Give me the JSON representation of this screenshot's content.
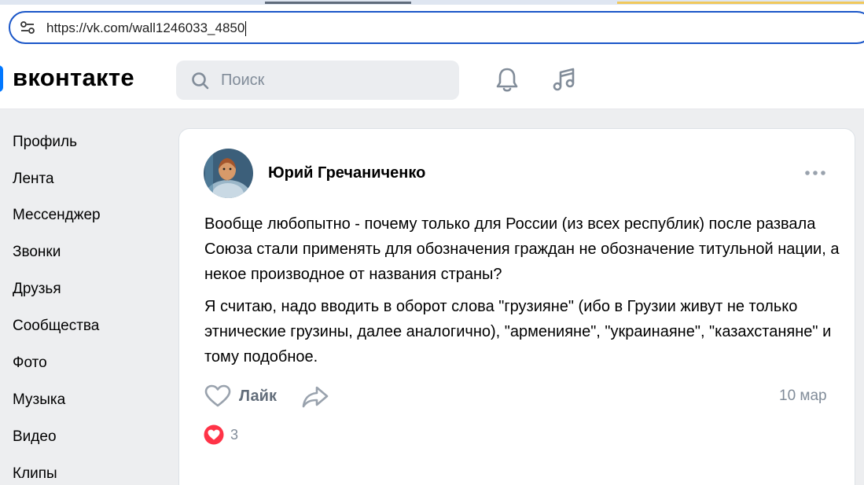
{
  "browser": {
    "url": "https://vk.com/wall1246033_4850"
  },
  "header": {
    "logo_text": "вконтакте",
    "search_placeholder": "Поиск",
    "icons": [
      "search-icon",
      "bell-icon",
      "music-icon"
    ]
  },
  "sidebar": {
    "items": [
      {
        "label": "Профиль"
      },
      {
        "label": "Лента"
      },
      {
        "label": "Мессенджер"
      },
      {
        "label": "Звонки"
      },
      {
        "label": "Друзья"
      },
      {
        "label": "Сообщества"
      },
      {
        "label": "Фото"
      },
      {
        "label": "Музыка"
      },
      {
        "label": "Видео"
      },
      {
        "label": "Клипы"
      }
    ]
  },
  "post": {
    "author": "Юрий Гречаниченко",
    "paragraphs": [
      "Вообще любопытно - почему только для России (из всех республик) после развала Союза стали применять для обозначения граждан не обозначение титульной нации, а некое производное от названия страны?",
      "Я считаю, надо вводить в оборот слова \"грузияне\" (ибо в Грузии живут не только этнические грузины, далее аналогично), \"армениянe\", \"украинаяне\", \"казахстаняне\" и тому подобное."
    ],
    "like_label": "Лайк",
    "date": "10 мар",
    "reaction_count": "3"
  },
  "colors": {
    "accent": "#0077ff",
    "url_border": "#1a56c8",
    "reaction_red": "#ff3347",
    "muted": "#818c99"
  }
}
